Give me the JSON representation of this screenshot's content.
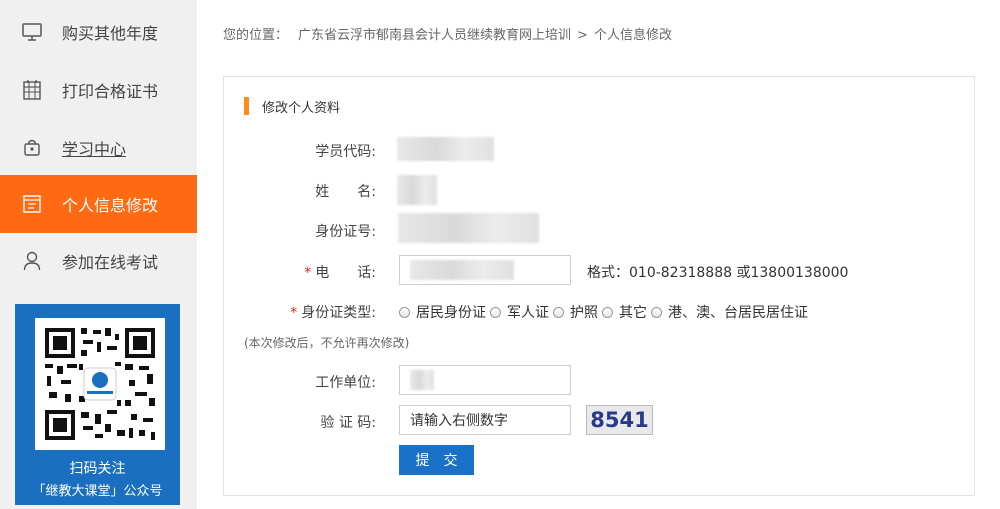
{
  "sidebar": {
    "items": [
      {
        "label": "购买其他年度",
        "icon": "monitor-icon"
      },
      {
        "label": "打印合格证书",
        "icon": "calendar-grid-icon"
      },
      {
        "label": "学习中心",
        "icon": "lock-bag-icon"
      },
      {
        "label": "个人信息修改",
        "icon": "document-icon"
      },
      {
        "label": "参加在线考试",
        "icon": "user-icon"
      }
    ],
    "active_index": 3,
    "qr": {
      "caption_line1": "扫码关注",
      "caption_line2": "「继教大课堂」公众号",
      "bg_color": "#1a6fc0"
    }
  },
  "breadcrumb": {
    "prefix": "您的位置：",
    "items": [
      "广东省云浮市郁南县会计人员继续教育网上培训",
      "个人信息修改"
    ],
    "separator": ">"
  },
  "form": {
    "section_title": "修改个人资料",
    "fields": {
      "student_code_label": "学员代码:",
      "name_label": "姓　　名:",
      "id_number_label": "身份证号:",
      "phone_label": "电　　话:",
      "phone_hint": "格式：010-82318888 或13800138000",
      "id_type_label": "身份证类型:",
      "id_type_options": [
        "居民身份证",
        "军人证",
        "护照",
        "其它",
        "港、澳、台居民居住证"
      ],
      "note": "(本次修改后，不允许再次修改)",
      "work_unit_label": "工作单位:",
      "captcha_label": "验 证 码:",
      "captcha_value": "请输入右侧数字",
      "captcha_image_text": "8541"
    },
    "submit_label": "提交"
  },
  "colors": {
    "accent_orange": "#ff6a13",
    "submit_blue": "#1a72c8",
    "required_red": "#e02020"
  }
}
